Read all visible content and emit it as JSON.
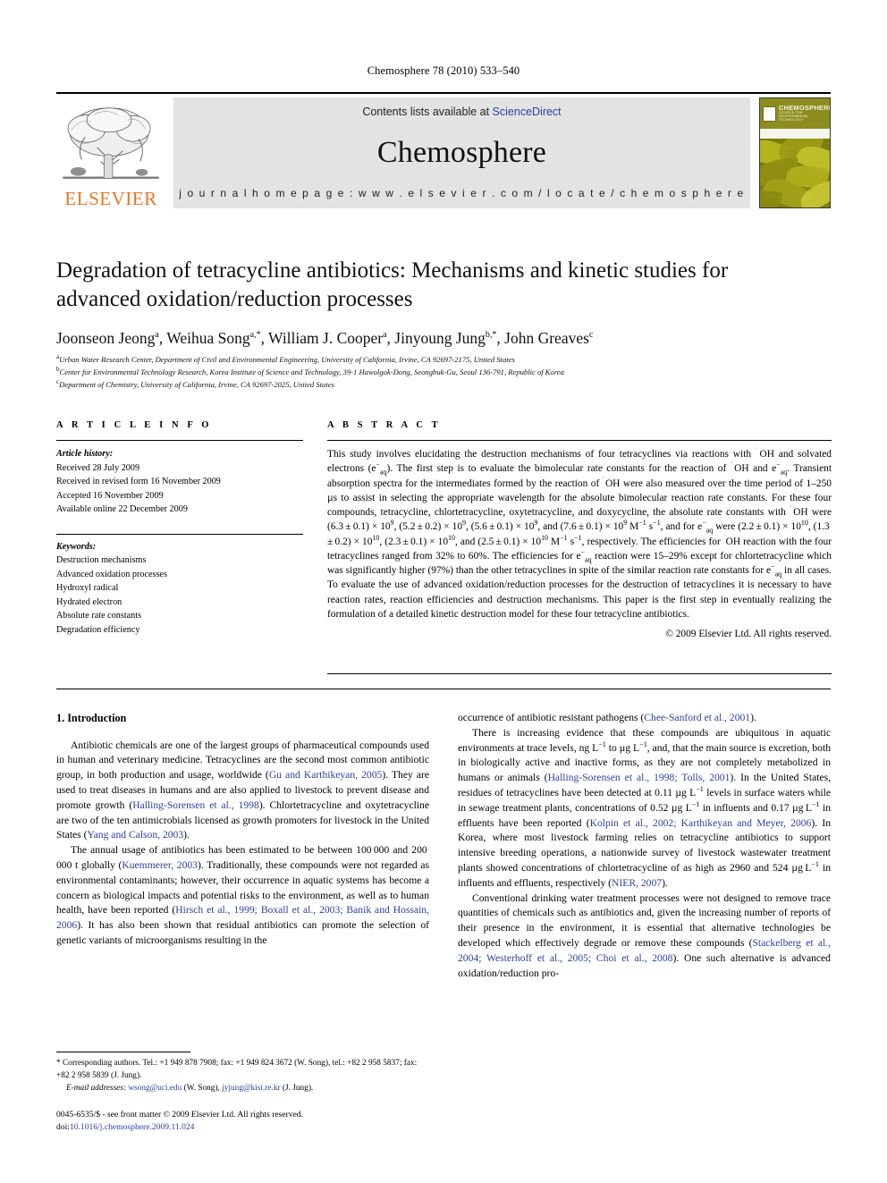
{
  "running_head": "Chemosphere 78 (2010) 533–540",
  "masthead": {
    "publisher": "ELSEVIER",
    "contents_prefix": "Contents lists available at ",
    "contents_link": "ScienceDirect",
    "journal_name": "Chemosphere",
    "homepage": "j o u r n a l   h o m e p a g e :   w w w . e l s e v i e r . c o m / l o c a t e / c h e m o s p h e r e",
    "cover": {
      "title": "CHEMOSPHERE",
      "subtitle": "SCIENCE FOR ENVIRONMENTAL TECHNOLOGY"
    }
  },
  "article": {
    "title": "Degradation of tetracycline antibiotics: Mechanisms and kinetic studies for advanced oxidation/reduction processes",
    "authors": "Joonseon Jeong a, Weihua Song a,*, William J. Cooper a, Jinyoung Jung b,*, John Greaves c",
    "affiliations": [
      "a Urban Water Research Center, Department of Civil and Environmental Engineering, University of California, Irvine, CA 92697-2175, United States",
      "b Center for Environmental Technology Research, Korea Institute of Science and Technology, 39-1 Hawolgok-Dong, Seongbuk-Gu, Seoul 136-791, Republic of Korea",
      "c Department of Chemistry, University of California, Irvine, CA 92697-2025, United States"
    ]
  },
  "info": {
    "heading": "A R T I C L E   I N F O",
    "history_label": "Article history:",
    "history": [
      "Received 28 July 2009",
      "Received in revised form 16 November 2009",
      "Accepted 16 November 2009",
      "Available online 22 December 2009"
    ],
    "keywords_label": "Keywords:",
    "keywords": [
      "Destruction mechanisms",
      "Advanced oxidation processes",
      "Hydroxyl radical",
      "Hydrated electron",
      "Absolute rate constants",
      "Degradation efficiency"
    ]
  },
  "abstract": {
    "heading": "A B S T R A C T",
    "text": "This study involves elucidating the destruction mechanisms of four tetracyclines via reactions with ˙OH and solvated electrons (e−aq). The first step is to evaluate the bimolecular rate constants for the reaction of ˙OH and e−aq. Transient absorption spectra for the intermediates formed by the reaction of ˙OH were also measured over the time period of 1–250 µs to assist in selecting the appropriate wavelength for the absolute bimolecular reaction rate constants. For these four compounds, tetracycline, chlortetracycline, oxytetracycline, and doxycycline, the absolute rate constants with ˙OH were (6.3 ± 0.1) × 10^9, (5.2 ± 0.2) × 10^9, (5.6 ± 0.1) × 10^9, and (7.6 ± 0.1) × 10^9 M−1 s−1, and for e−aq were (2.2 ± 0.1) × 10^10, (1.3 ± 0.2) × 10^10, (2.3 ± 0.1) × 10^10, and (2.5 ± 0.1) × 10^10 M−1 s−1, respectively. The efficiencies for ˙OH reaction with the four tetracyclines ranged from 32% to 60%. The efficiencies for e−aq reaction were 15–29% except for chlortetracycline which was significantly higher (97%) than the other tetracyclines in spite of the similar reaction rate constants for e−aq in all cases. To evaluate the use of advanced oxidation/reduction processes for the destruction of tetracyclines it is necessary to have reaction rates, reaction efficiencies and destruction mechanisms. This paper is the first step in eventually realizing the formulation of a detailed kinetic destruction model for these four tetracycline antibiotics.",
    "copyright": "© 2009 Elsevier Ltd. All rights reserved."
  },
  "body": {
    "section_heading": "1. Introduction",
    "left_paragraphs": [
      "Antibiotic chemicals are one of the largest groups of pharmaceutical compounds used in human and veterinary medicine. Tetracyclines are the second most common antibiotic group, in both production and usage, worldwide (Gu and Karthikeyan, 2005). They are used to treat diseases in humans and are also applied to livestock to prevent disease and promote growth (Halling-Sorensen et al., 1998). Chlortetracycline and oxytetracycline are two of the ten antimicrobials licensed as growth promoters for livestock in the United States (Yang and Calson, 2003).",
      "The annual usage of antibiotics has been estimated to be between 100 000 and 200 000 t globally (Kuemmerer, 2003). Traditionally, these compounds were not regarded as environmental contaminants; however, their occurrence in aquatic systems has become a concern as biological impacts and potential risks to the environment, as well as to human health, have been reported (Hirsch et al., 1999; Boxall et al., 2003; Banik and Hossain, 2006). It has also been shown that residual antibiotics can promote the selection of genetic variants of microorganisms resulting in the"
    ],
    "right_paragraphs": [
      "occurrence of antibiotic resistant pathogens (Chee-Sanford et al., 2001).",
      "There is increasing evidence that these compounds are ubiquitous in aquatic environments at trace levels, ng L−1 to µg L−1, and, that the main source is excretion, both in biologically active and inactive forms, as they are not completely metabolized in humans or animals (Halling-Sorensen et al., 1998; Tolls, 2001). In the United States, residues of tetracyclines have been detected at 0.11 µg L−1 levels in surface waters while in sewage treatment plants, concentrations of 0.52 µg L−1 in influents and 0.17 µg L−1 in effluents have been reported (Kolpin et al., 2002; Karthikeyan and Meyer, 2006). In Korea, where most livestock farming relies on tetracycline antibiotics to support intensive breeding operations, a nationwide survey of livestock wastewater treatment plants showed concentrations of chlortetracycline of as high as 2960 and 524 µg L−1 in influents and effluents, respectively (NIER, 2007).",
      "Conventional drinking water treatment processes were not designed to remove trace quantities of chemicals such as antibiotics and, given the increasing number of reports of their presence in the environment, it is essential that alternative technologies be developed which effectively degrade or remove these compounds (Stackelberg et al., 2004; Westerhoff et al., 2005; Choi et al., 2008). One such alternative is advanced oxidation/reduction pro-"
    ]
  },
  "footnotes": {
    "corresponding": "* Corresponding authors. Tel.: +1 949 878 7908; fax: +1 949 824 3672 (W. Song), tel.: +82 2 958 5837; fax: +82 2 958 5839 (J. Jung).",
    "email_label": "E-mail addresses:",
    "email1": "wsong@uci.edu",
    "email1_owner": " (W. Song), ",
    "email2": "jyjung@kist.re.kr",
    "email2_owner": " (J. Jung)."
  },
  "imprint": {
    "issn_line": "0045-6535/$ - see front matter © 2009 Elsevier Ltd. All rights reserved.",
    "doi_label": "doi:",
    "doi": "10.1016/j.chemosphere.2009.11.024"
  },
  "colors": {
    "link": "#2b3fa0",
    "elsevier_orange": "#E87722",
    "band_gray": "#e3e3e3",
    "cover_olive": "#8d8d1f"
  }
}
